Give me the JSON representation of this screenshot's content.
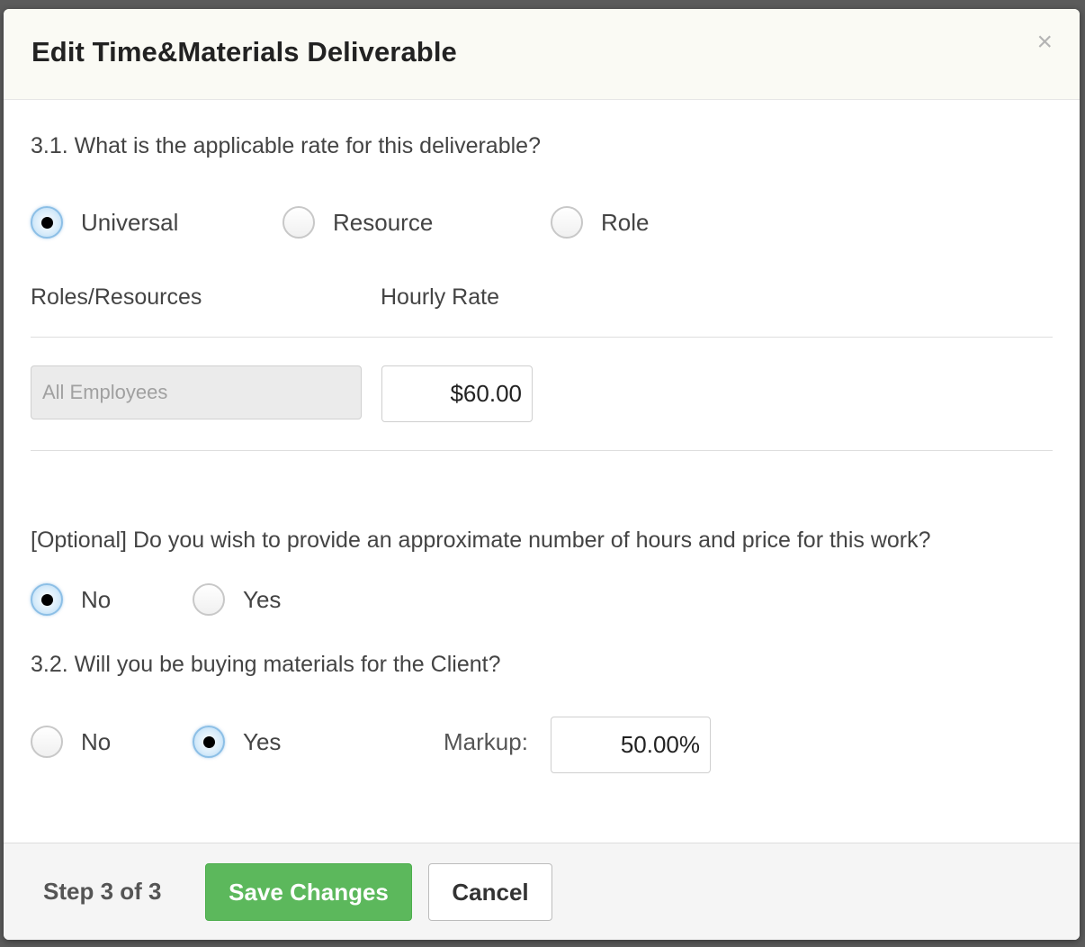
{
  "modal": {
    "title": "Edit Time&Materials Deliverable",
    "close_glyph": "×"
  },
  "rate_section": {
    "question": "3.1. What is the applicable rate for this deliverable?",
    "options": [
      {
        "label": "Universal",
        "checked": true
      },
      {
        "label": "Resource",
        "checked": false
      },
      {
        "label": "Role",
        "checked": false
      }
    ],
    "columns": {
      "roles": "Roles/Resources",
      "rate": "Hourly Rate"
    },
    "row": {
      "role_placeholder": "All Employees",
      "rate_value": "$60.00"
    }
  },
  "estimate_section": {
    "question": "[Optional] Do you wish to provide an approximate number of hours and price for this work?",
    "options": [
      {
        "label": "No",
        "checked": true
      },
      {
        "label": "Yes",
        "checked": false
      }
    ]
  },
  "materials_section": {
    "question": "3.2. Will you be buying materials for the Client?",
    "options": [
      {
        "label": "No",
        "checked": false
      },
      {
        "label": "Yes",
        "checked": true
      }
    ],
    "markup_label": "Markup:",
    "markup_value": "50.00%"
  },
  "footer": {
    "step": "Step 3 of 3",
    "save_label": "Save Changes",
    "cancel_label": "Cancel"
  },
  "colors": {
    "save_button": "#5cb85c",
    "header_background": "#fafaf4",
    "footer_background": "#f5f5f5"
  }
}
